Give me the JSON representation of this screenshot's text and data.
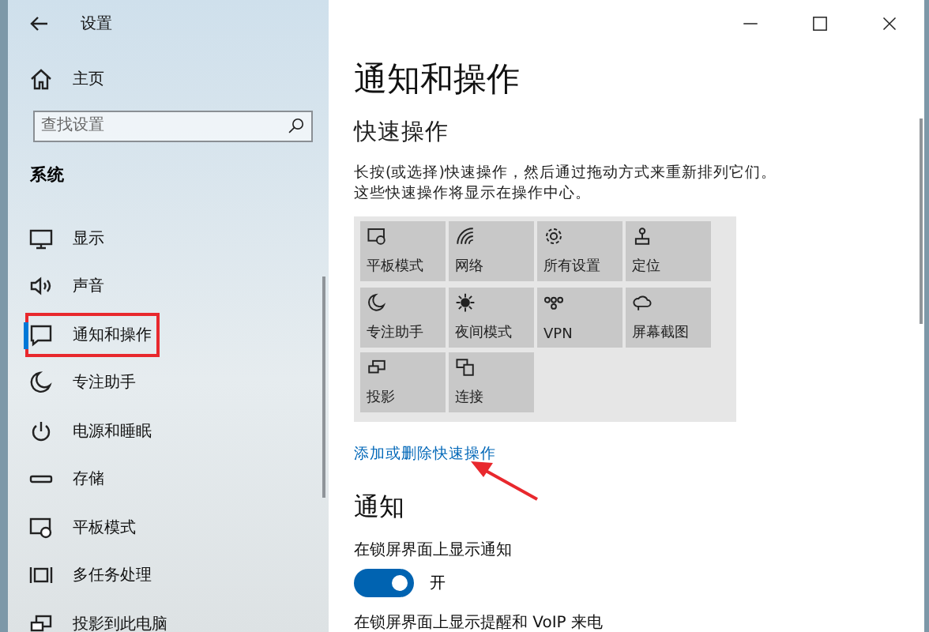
{
  "window": {
    "title": "设置"
  },
  "sidebar": {
    "home": "主页",
    "search": {
      "placeholder": "查找设置"
    },
    "section": "系统",
    "items": [
      {
        "label": "显示",
        "selected": false,
        "highlighted": false
      },
      {
        "label": "声音",
        "selected": false,
        "highlighted": false
      },
      {
        "label": "通知和操作",
        "selected": true,
        "highlighted": true
      },
      {
        "label": "专注助手",
        "selected": false,
        "highlighted": false
      },
      {
        "label": "电源和睡眠",
        "selected": false,
        "highlighted": false
      },
      {
        "label": "存储",
        "selected": false,
        "highlighted": false
      },
      {
        "label": "平板模式",
        "selected": false,
        "highlighted": false
      },
      {
        "label": "多任务处理",
        "selected": false,
        "highlighted": false
      },
      {
        "label": "投影到此电脑",
        "selected": false,
        "highlighted": false
      }
    ]
  },
  "content": {
    "title": "通知和操作",
    "quick_actions": {
      "heading": "快速操作",
      "description": "长按(或选择)快速操作，然后通过拖动方式来重新排列它们。这些快速操作将显示在操作中心。",
      "tiles": [
        {
          "label": "平板模式"
        },
        {
          "label": "网络"
        },
        {
          "label": "所有设置"
        },
        {
          "label": "定位"
        },
        {
          "label": "专注助手"
        },
        {
          "label": "夜间模式"
        },
        {
          "label": "VPN"
        },
        {
          "label": "屏幕截图"
        },
        {
          "label": "投影"
        },
        {
          "label": "连接"
        }
      ],
      "link": {
        "label": "添加或删除快速操作",
        "annotated": true
      }
    },
    "notifications": {
      "heading": "通知",
      "settings": [
        {
          "kind": "toggle",
          "label": "在锁屏界面上显示通知",
          "on": true,
          "state_label": "开"
        },
        {
          "kind": "text",
          "label": "在锁屏界面上显示提醒和 VoIP 来电"
        }
      ]
    }
  }
}
